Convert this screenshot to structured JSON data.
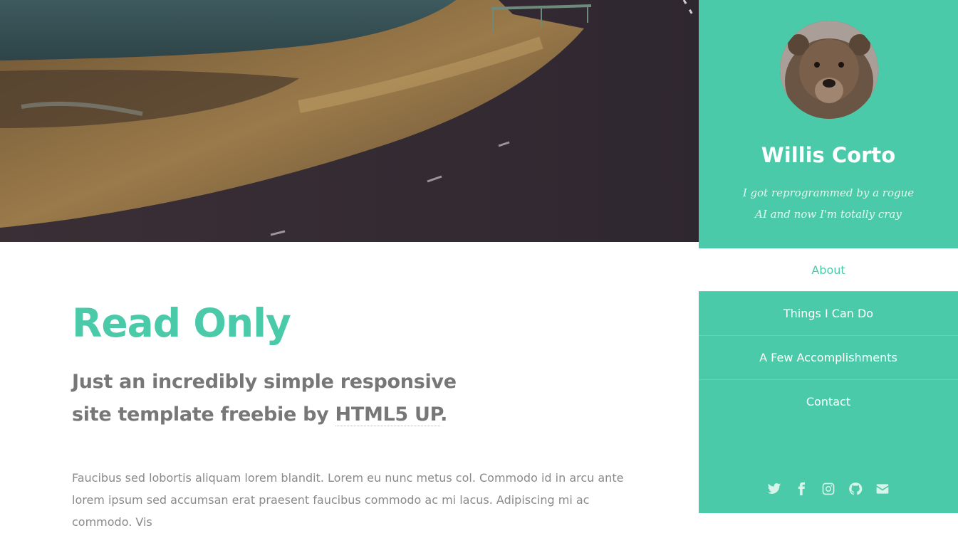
{
  "banner": {
    "image_description": "coastal road landscape"
  },
  "main": {
    "title": "Read Only",
    "subtitle_prefix": "Just an incredibly simple responsive site template freebie by ",
    "subtitle_link": "HTML5 UP",
    "subtitle_suffix": ".",
    "body": "Faucibus sed lobortis aliquam lorem blandit. Lorem eu nunc metus col. Commodo id in arcu ante lorem ipsum sed accumsan erat praesent faucibus commodo ac mi lacus. Adipiscing mi ac commodo. Vis"
  },
  "sidebar": {
    "name": "Willis Corto",
    "tagline": "I got reprogrammed by a rogue AI and now I'm totally cray",
    "nav": [
      {
        "label": "About"
      },
      {
        "label": "Things I Can Do"
      },
      {
        "label": "A Few Accomplishments"
      },
      {
        "label": "Contact"
      }
    ],
    "social": [
      "twitter-icon",
      "facebook-icon",
      "instagram-icon",
      "github-icon",
      "envelope-icon"
    ]
  },
  "colors": {
    "accent": "#4acaa8",
    "text": "#777777",
    "sidebar_bg": "#4acaa8"
  }
}
